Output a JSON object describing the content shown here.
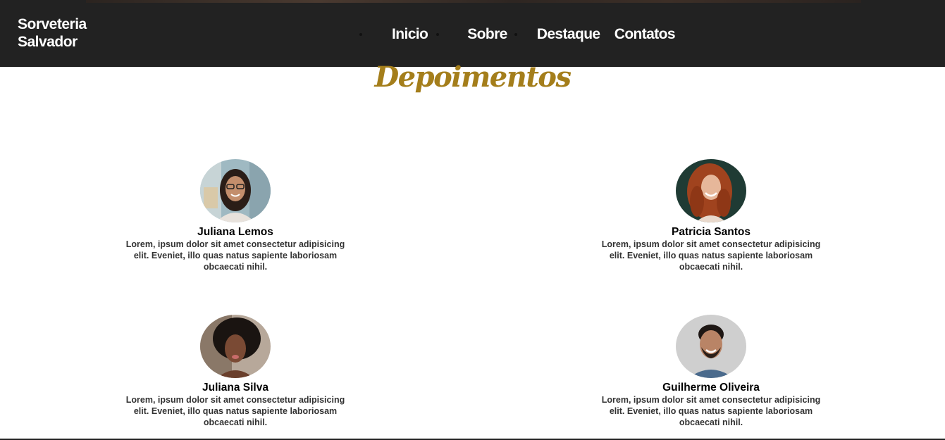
{
  "header": {
    "brand_line1": "Sorveteria",
    "brand_line2": "Salvador",
    "nav": [
      {
        "label": "Inicio"
      },
      {
        "label": "Sobre"
      },
      {
        "label": "Destaque"
      },
      {
        "label": "Contatos"
      }
    ]
  },
  "testimonials": {
    "title": "Depoimentos",
    "items": [
      {
        "name": "Juliana Lemos",
        "text": "Lorem, ipsum dolor sit amet consectetur adipisicing elit. Eveniet, illo quas natus sapiente laboriosam obcaecati nihil."
      },
      {
        "name": "Patricia Santos",
        "text": "Lorem, ipsum dolor sit amet consectetur adipisicing elit. Eveniet, illo quas natus sapiente laboriosam obcaecati nihil."
      },
      {
        "name": "Juliana Silva",
        "text": "Lorem, ipsum dolor sit amet consectetur adipisicing elit. Eveniet, illo quas natus sapiente laboriosam obcaecati nihil."
      },
      {
        "name": "Guilherme Oliveira",
        "text": "Lorem, ipsum dolor sit amet consectetur adipisicing elit. Eveniet, illo quas natus sapiente laboriosam obcaecati nihil."
      }
    ]
  },
  "colors": {
    "navbar": "#222222",
    "accent": "#a47e1b",
    "text": "#333333"
  }
}
